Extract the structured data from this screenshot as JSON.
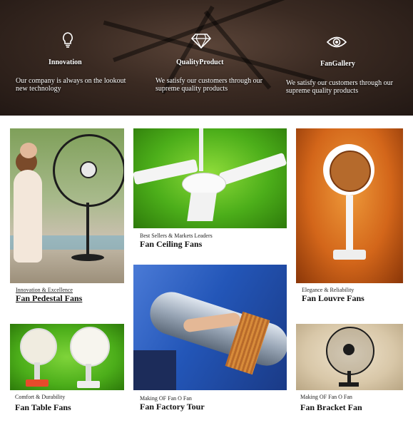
{
  "features": [
    {
      "icon": "lightbulb-icon",
      "title": "Innovation",
      "desc": "Our company is always on the lookout new technology"
    },
    {
      "icon": "diamond-icon",
      "title": "QualityProduct",
      "desc": "We satisfy our customers through our supreme quality products"
    },
    {
      "icon": "eye-icon",
      "title": "FanGallery",
      "desc": "We satisfy our customers through our supreme quality products"
    }
  ],
  "cards": [
    {
      "subtitle": "Innovation & Excellence",
      "title": "Fan Pedestal Fans"
    },
    {
      "subtitle": "Best Sellers & Markets Leaders",
      "title": "Fan Ceiling Fans"
    },
    {
      "subtitle": "Elegance & Reliability",
      "title": "Fan Louvre Fans"
    },
    {
      "subtitle": "Comfort & Durability",
      "title": "Fan Table Fans"
    },
    {
      "subtitle": "Making OF Fan O Fan",
      "title": "Fan Factory Tour"
    },
    {
      "subtitle": "Making OF Fan O Fan",
      "title": "Fan Bracket Fan"
    }
  ],
  "colors": {
    "hero_bg": "#2b1f1a",
    "green": "#4cae1a",
    "orange": "#d3661a",
    "blue": "#2356b8",
    "beige": "#d8c7a8"
  }
}
